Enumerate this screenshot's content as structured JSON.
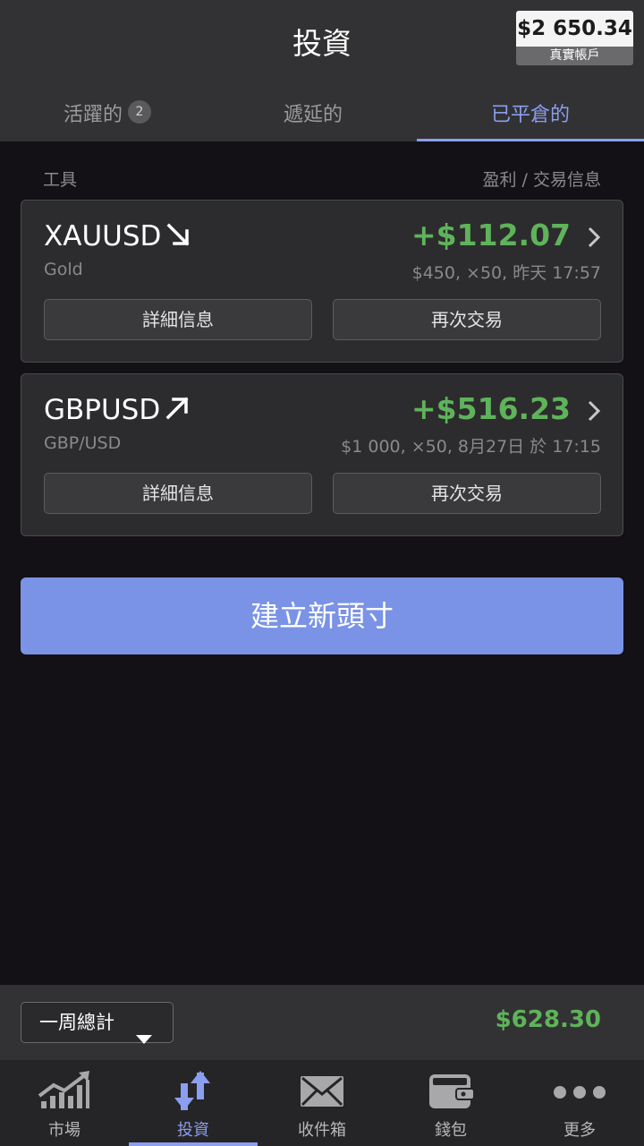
{
  "header": {
    "title": "投資",
    "balance_amount": "$2 650.34",
    "balance_label": "真實帳戶"
  },
  "tabs": [
    {
      "label": "活躍的",
      "badge": "2"
    },
    {
      "label": "遞延的"
    },
    {
      "label": "已平倉的",
      "active": true
    }
  ],
  "columns": {
    "left": "工具",
    "right": "盈利 / 交易信息"
  },
  "positions": [
    {
      "symbol": "XAUUSD",
      "direction_icon": "arrow-down-right-icon",
      "name": "Gold",
      "pnl": "+$112.07",
      "meta": "$450, ×50, 昨天 17:57",
      "details_label": "詳細信息",
      "retrade_label": "再次交易"
    },
    {
      "symbol": "GBPUSD",
      "direction_icon": "arrow-up-right-icon",
      "name": "GBP/USD",
      "pnl": "+$516.23",
      "meta": "$1 000, ×50, 8月27日 於 17:15",
      "details_label": "詳細信息",
      "retrade_label": "再次交易"
    }
  ],
  "new_position_label": "建立新頭寸",
  "summary": {
    "period": "一周總計",
    "total": "$628.30"
  },
  "nav": [
    {
      "label": "市場",
      "icon": "chart-icon"
    },
    {
      "label": "投資",
      "icon": "trade-arrows-icon",
      "active": true
    },
    {
      "label": "收件箱",
      "icon": "envelope-icon"
    },
    {
      "label": "錢包",
      "icon": "wallet-icon"
    },
    {
      "label": "更多",
      "icon": "more-dots-icon"
    }
  ],
  "colors": {
    "accent": "#8b9ef0",
    "profit": "#5fb35a",
    "button": "#7a93e6",
    "background": "#131116",
    "header": "#323234"
  }
}
